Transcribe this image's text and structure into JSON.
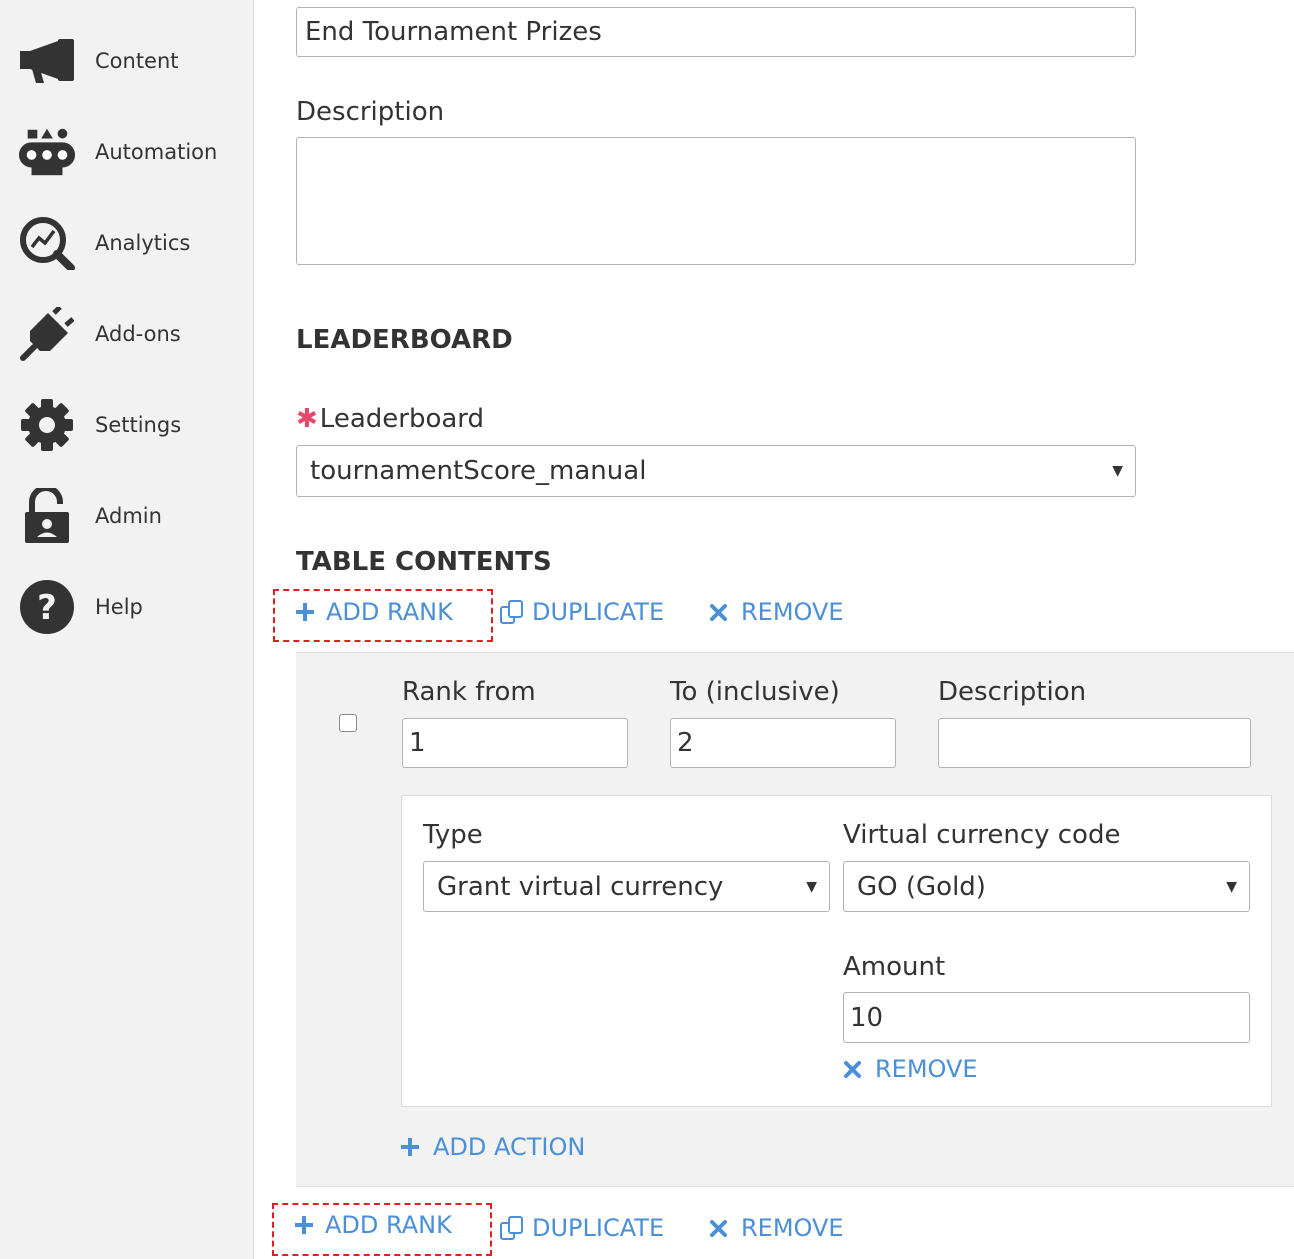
{
  "sidebar": {
    "items": [
      {
        "label": "Content",
        "icon": "megaphone-icon"
      },
      {
        "label": "Automation",
        "icon": "automation-icon"
      },
      {
        "label": "Analytics",
        "icon": "analytics-icon"
      },
      {
        "label": "Add-ons",
        "icon": "plug-icon"
      },
      {
        "label": "Settings",
        "icon": "gear-icon"
      },
      {
        "label": "Admin",
        "icon": "lock-icon"
      },
      {
        "label": "Help",
        "icon": "help-icon"
      }
    ]
  },
  "form": {
    "name_value": "End Tournament Prizes",
    "description_label": "Description",
    "description_value": "",
    "leaderboard_section_title": "LEADERBOARD",
    "leaderboard_required_mark": "✱",
    "leaderboard_label": "Leaderboard",
    "leaderboard_value": "tournamentScore_manual",
    "table_contents_title": "TABLE CONTENTS"
  },
  "toolbar": {
    "add_rank": "ADD RANK",
    "duplicate": "DUPLICATE",
    "remove": "REMOVE"
  },
  "rank": {
    "rank_from_label": "Rank from",
    "rank_from_value": "1",
    "to_label": "To (inclusive)",
    "to_value": "2",
    "description_label": "Description",
    "description_value": "",
    "action": {
      "type_label": "Type",
      "type_value": "Grant virtual currency",
      "currency_label": "Virtual currency code",
      "currency_value": "GO (Gold)",
      "amount_label": "Amount",
      "amount_value": "10",
      "remove_label": "REMOVE"
    },
    "add_action_label": "ADD ACTION"
  },
  "colors": {
    "accent": "#4a8fd8",
    "required": "#e8476a",
    "highlight_dash": "#e02020",
    "sidebar_bg": "#f2f2f2"
  }
}
